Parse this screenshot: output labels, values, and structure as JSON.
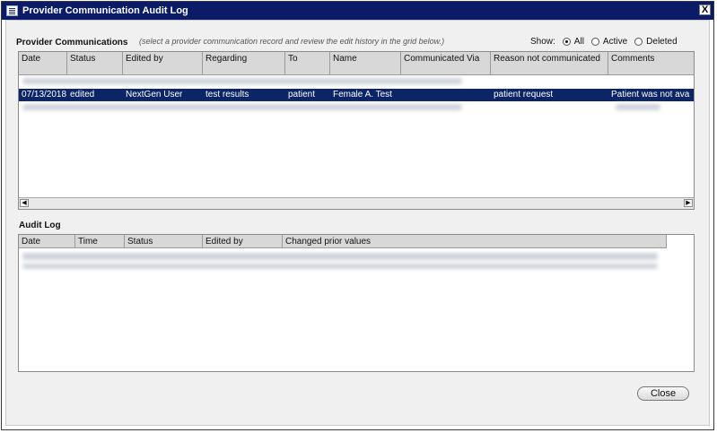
{
  "window": {
    "title": "Provider Communication Audit Log",
    "close_glyph": "X"
  },
  "provider_comms": {
    "label": "Provider Communications",
    "hint": "(select a provider communication record and review the edit history in the grid below.)",
    "show_label": "Show:",
    "filters": [
      {
        "label": "All",
        "checked": true
      },
      {
        "label": "Active",
        "checked": false
      },
      {
        "label": "Deleted",
        "checked": false
      }
    ],
    "columns": [
      "Date",
      "Status",
      "Edited by",
      "Regarding",
      "To",
      "Name",
      "Communicated Via",
      "Reason not communicated",
      "Comments"
    ],
    "selected_row": [
      "07/13/2018",
      "edited",
      "NextGen User",
      "test results",
      "patient",
      "Female A. Test",
      "",
      "patient request",
      "Patient was not ava"
    ]
  },
  "audit_log": {
    "label": "Audit Log",
    "columns": [
      "Date",
      "Time",
      "Status",
      "Edited by",
      "Changed prior values"
    ]
  },
  "footer": {
    "close_label": "Close"
  }
}
